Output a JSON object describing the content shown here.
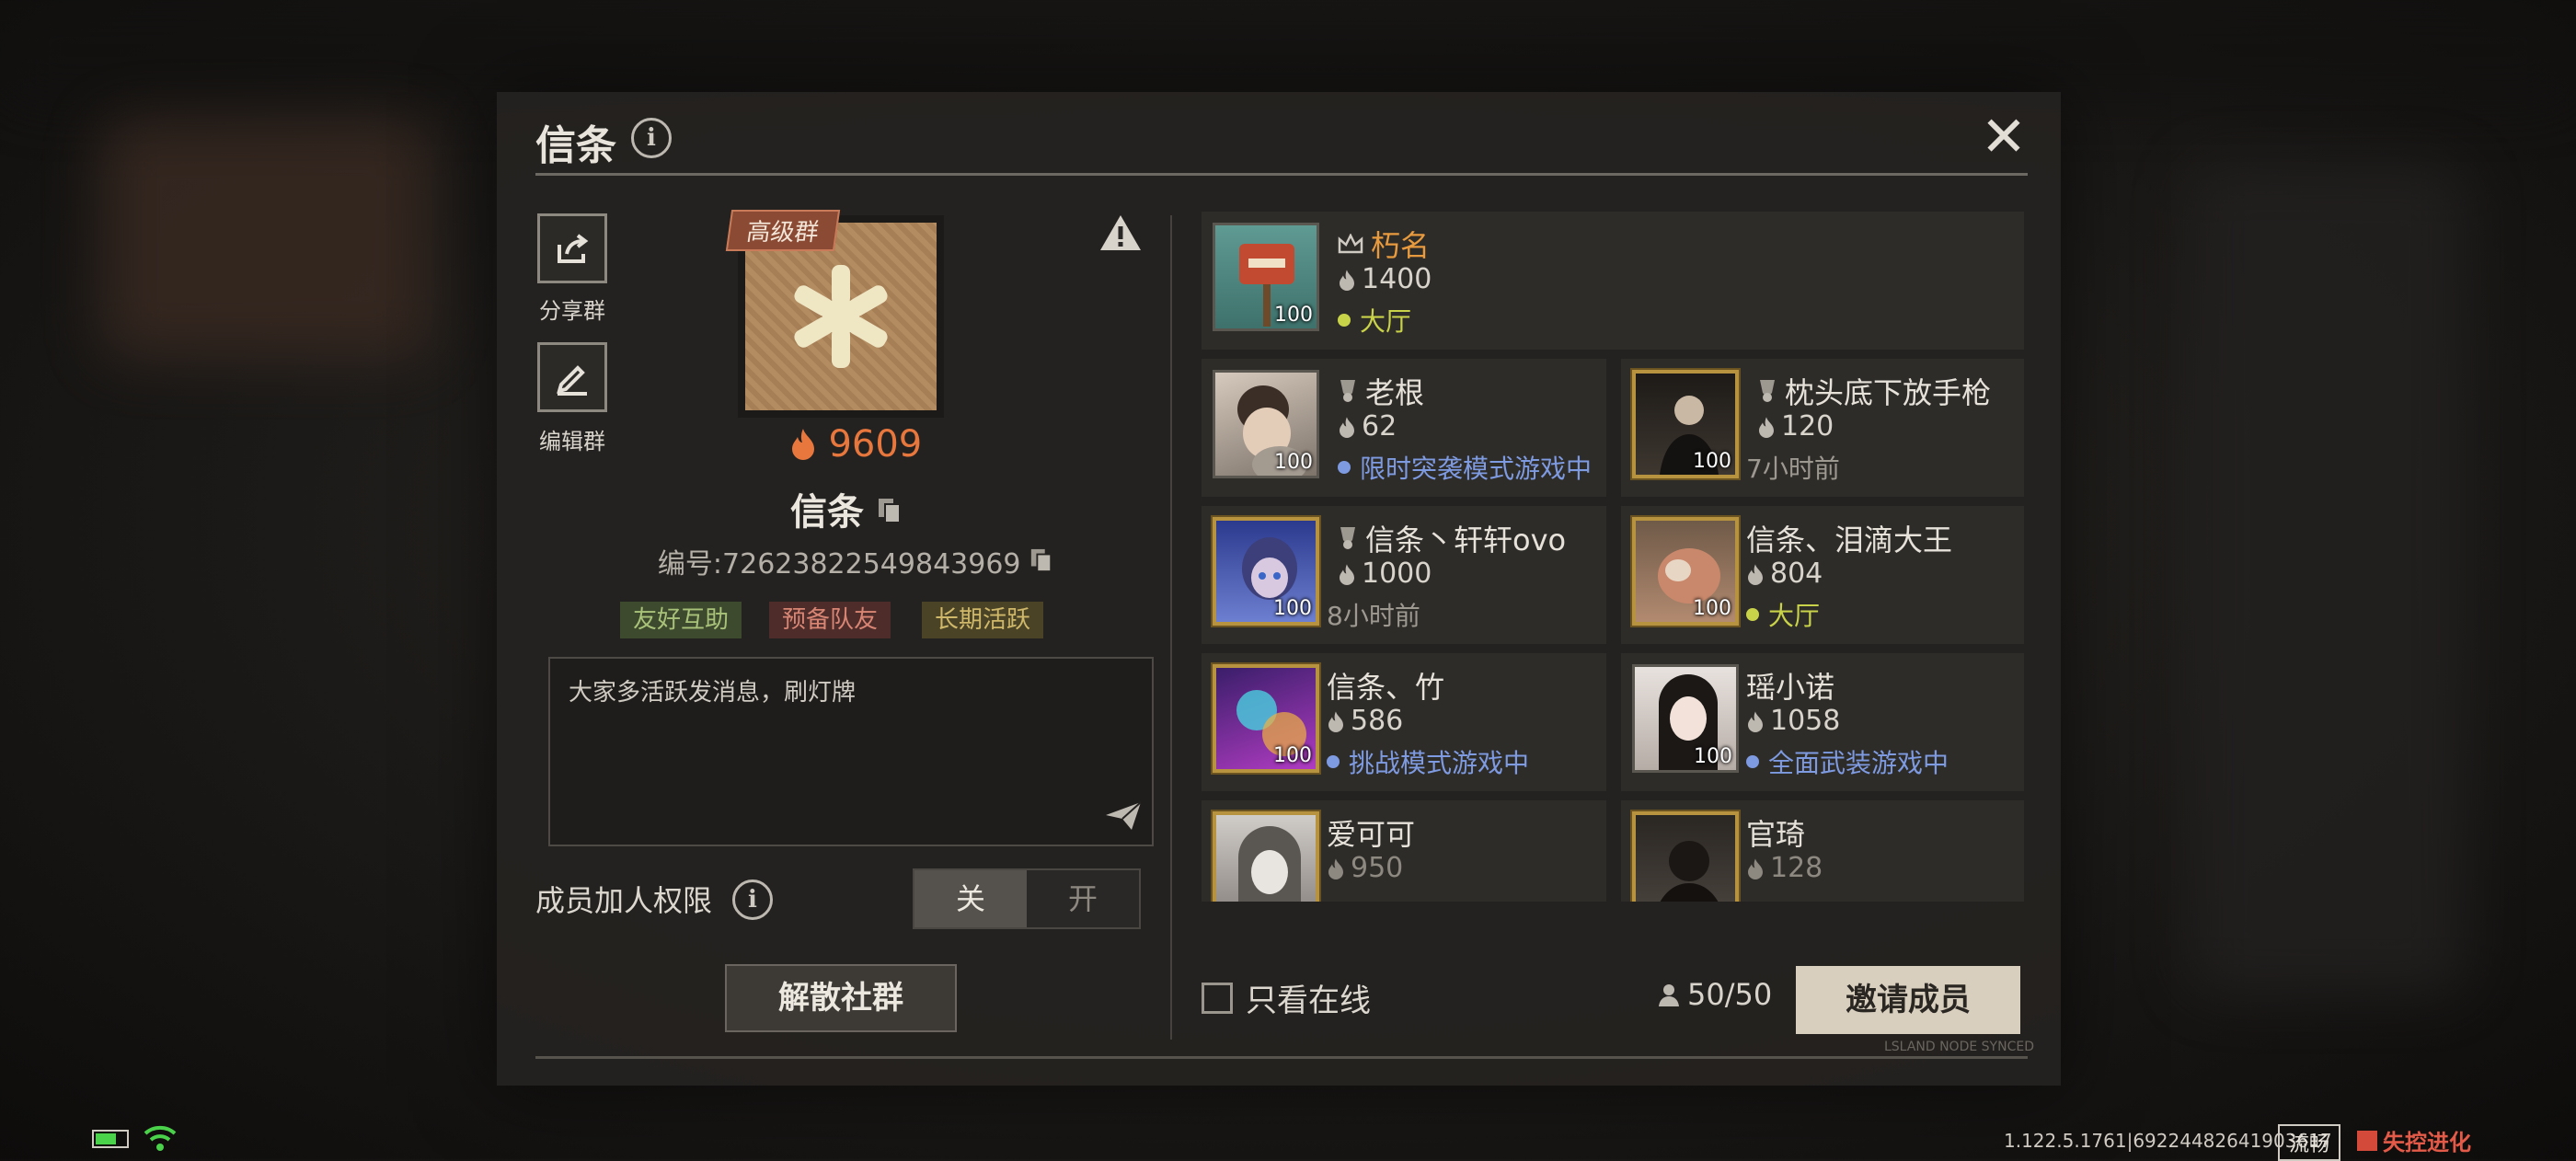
{
  "header": {
    "title": "信条"
  },
  "left": {
    "share_label": "分享群",
    "edit_label": "编辑群",
    "badge": "高级群",
    "score": "9609",
    "group_name": "信条",
    "group_id": "编号:72623822549843969",
    "tags": [
      "友好互助",
      "预备队友",
      "长期活跃"
    ],
    "notice": "大家多活跃发消息，刷灯牌",
    "permission_label": "成员加人权限",
    "toggle_off": "关",
    "toggle_on": "开",
    "disband": "解散社群"
  },
  "members": [
    {
      "name": "朽名",
      "score": "1400",
      "status": "大厅",
      "status_color": "#c9d34a",
      "level": "100",
      "role": "owner"
    },
    {
      "name": "老根",
      "score": "62",
      "status": "限时突袭模式游戏中",
      "status_color": "#7e9ae0",
      "level": "100",
      "role": "admin"
    },
    {
      "name": "枕头底下放手枪",
      "score": "120",
      "status": "7小时前",
      "status_color": "",
      "level": "100",
      "role": "admin"
    },
    {
      "name": "信条丶轩轩ovo",
      "score": "1000",
      "status": "8小时前",
      "status_color": "",
      "level": "100",
      "role": "admin"
    },
    {
      "name": "信条、泪滴大王",
      "score": "804",
      "status": "大厅",
      "status_color": "#c9d34a",
      "level": "100",
      "role": ""
    },
    {
      "name": "信条、竹",
      "score": "586",
      "status": "挑战模式游戏中",
      "status_color": "#7e9ae0",
      "level": "100",
      "role": ""
    },
    {
      "name": "瑶小诺",
      "score": "1058",
      "status": "全面武装游戏中",
      "status_color": "#7e9ae0",
      "level": "100",
      "role": ""
    },
    {
      "name": "爱可可",
      "score": "950",
      "status": "",
      "status_color": "",
      "level": "",
      "role": ""
    },
    {
      "name": "官琦",
      "score": "128",
      "status": "",
      "status_color": "",
      "level": "",
      "role": ""
    }
  ],
  "footer": {
    "only_online": "只看在线",
    "member_count": "50/50",
    "invite": "邀请成员",
    "synced": "LSLAND NODE SYNCED"
  },
  "statusbar": {
    "version": "1.122.5.1761|69224482641903617",
    "smooth": "流畅",
    "logo": "失控进化"
  },
  "colors": {
    "accent_orange": "#e8773d",
    "online_green": "#c9d34a",
    "ingame_blue": "#7e9ae0"
  },
  "icons": [
    "info-icon",
    "close-icon",
    "share-icon",
    "edit-icon",
    "snowflake-icon",
    "warning-icon",
    "flame-icon",
    "copy-icon",
    "send-icon",
    "crown-icon",
    "medal-icon",
    "person-icon",
    "battery-icon",
    "wifi-icon"
  ]
}
